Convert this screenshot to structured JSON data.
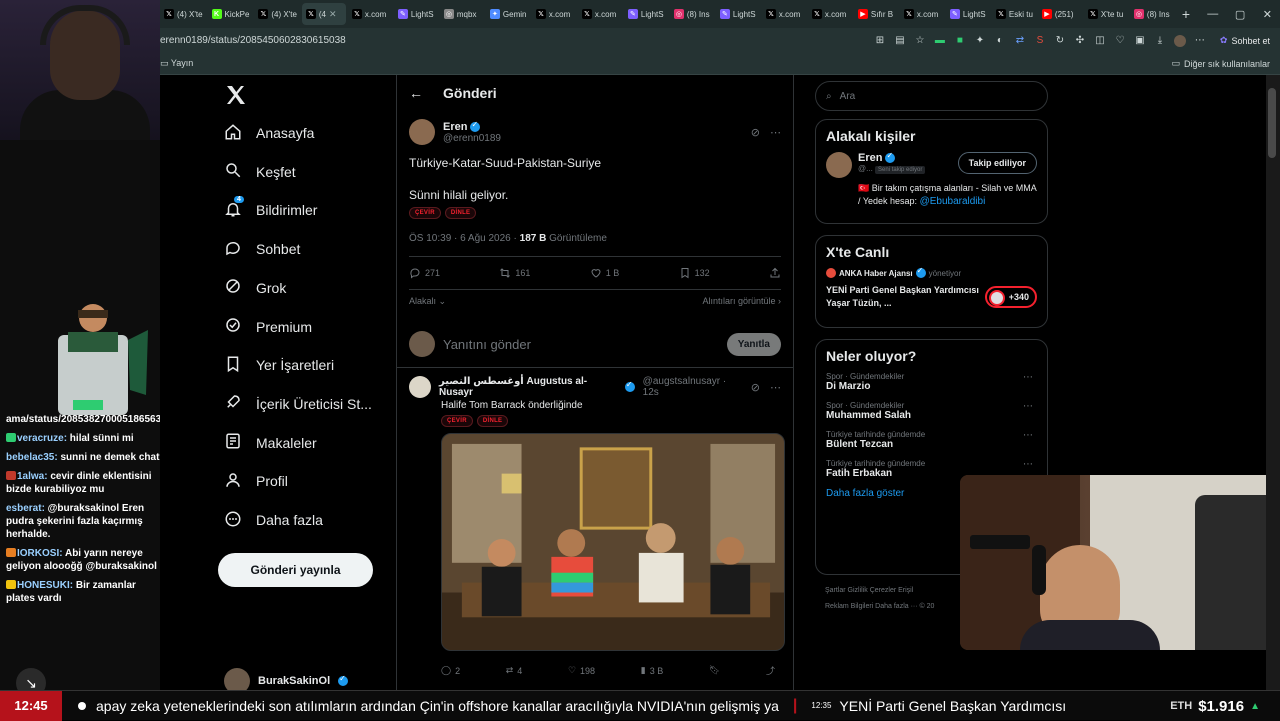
{
  "browser": {
    "tabs": [
      {
        "label": "(4) X'te",
        "icon": "x"
      },
      {
        "label": "KickPe",
        "icon": "kick"
      },
      {
        "label": "(4) X'te",
        "icon": "x"
      },
      {
        "label": "(4",
        "icon": "x",
        "active": true
      },
      {
        "label": "x.com",
        "icon": "x"
      },
      {
        "label": "LightS",
        "icon": "lightshot"
      },
      {
        "label": "mqbx",
        "icon": "globe"
      },
      {
        "label": "Gemin",
        "icon": "gemini"
      },
      {
        "label": "x.com",
        "icon": "x"
      },
      {
        "label": "x.com",
        "icon": "x"
      },
      {
        "label": "LightS",
        "icon": "lightshot"
      },
      {
        "label": "(8) Ins",
        "icon": "instagram"
      },
      {
        "label": "LightS",
        "icon": "lightshot"
      },
      {
        "label": "x.com",
        "icon": "x"
      },
      {
        "label": "x.com",
        "icon": "x"
      },
      {
        "label": "Sıfır B",
        "icon": "youtube"
      },
      {
        "label": "x.com",
        "icon": "x"
      },
      {
        "label": "LightS",
        "icon": "lightshot"
      },
      {
        "label": "Eski tu",
        "icon": "x"
      },
      {
        "label": "(251)",
        "icon": "youtube"
      },
      {
        "label": "X'te tu",
        "icon": "x"
      },
      {
        "label": "(8) Ins",
        "icon": "instagram"
      }
    ],
    "url": "erenn0189/status/2085450602830615038",
    "sohbet_label": "Sohbet et",
    "bookmark_left": "Yayın",
    "bookmark_right": "Diğer sık kullanılanlar"
  },
  "chat": {
    "messages": [
      {
        "user": "",
        "text": "ama/status/2085382700051865635",
        "badge": ""
      },
      {
        "user": "veracruze:",
        "text": " hilal sünni mi",
        "badge": "#2ecc71"
      },
      {
        "user": "bebelac35:",
        "text": " sunni ne demek chat?",
        "badge": ""
      },
      {
        "user": "1alwa:",
        "text": " cevir dinle eklentisini bizde kurabiliyoz mu",
        "badge": "#c0392b"
      },
      {
        "user": "esberat:",
        "text": " @buraksakinol Eren pudra şekerini fazla kaçırmış herhalde.",
        "badge": ""
      },
      {
        "user": "IORKOSI:",
        "text": " Abi yarın nereye geliyon aloooğğ @buraksakinol",
        "badge": "#e67e22"
      },
      {
        "user": "HONESUKI:",
        "text": " Bir zamanlar plates vardı",
        "badge": "#f1c40f"
      }
    ]
  },
  "nav": {
    "items": [
      {
        "label": "Anasayfa",
        "icon": "home-icon"
      },
      {
        "label": "Keşfet",
        "icon": "search-icon"
      },
      {
        "label": "Bildirimler",
        "icon": "bell-icon",
        "badge": "4"
      },
      {
        "label": "Sohbet",
        "icon": "chat-icon"
      },
      {
        "label": "Grok",
        "icon": "grok-icon"
      },
      {
        "label": "Premium",
        "icon": "premium-icon"
      },
      {
        "label": "Yer İşaretleri",
        "icon": "bookmark-icon"
      },
      {
        "label": "İçerik Üreticisi St...",
        "icon": "rocket-icon"
      },
      {
        "label": "Makaleler",
        "icon": "article-icon"
      },
      {
        "label": "Profil",
        "icon": "profile-icon"
      },
      {
        "label": "Daha fazla",
        "icon": "more-icon"
      }
    ],
    "post_button": "Gönderi yayınla",
    "account_name": "BurakSakinOl"
  },
  "main": {
    "header_title": "Gönderi",
    "tweet": {
      "name": "Eren",
      "handle": "@erenn0189",
      "line1": "Türkiye-Katar-Suud-Pakistan-Suriye",
      "line2": "Sünni hilali geliyor.",
      "chip1": "ÇEVİR",
      "chip2": "DİNLE",
      "time": "ÖS 10:39 · 6 Ağu 2026 · ",
      "views": "187 B",
      "views_label": " Görüntüleme",
      "replies": "271",
      "retweets": "161",
      "likes": "1 B",
      "bookmarks": "132",
      "relevance": "Alakalı",
      "quotes_link": "Alıntıları görüntüle"
    },
    "reply": {
      "placeholder": "Yanıtını gönder",
      "button": "Yanıtla"
    },
    "tweet2": {
      "name": "أوغسطس النصير Augustus al-Nusayr",
      "handle": "@augstsalnusayr · 12s",
      "text": "Halife Tom Barrack önderliğinde",
      "chip1": "ÇEVİR",
      "chip2": "DİNLE",
      "replies": "2",
      "retweets": "4",
      "likes": "198",
      "views": "3 B"
    }
  },
  "right": {
    "search_placeholder": "Ara",
    "related_title": "Alakalı kişiler",
    "related_person": {
      "name": "Eren",
      "handle": "@...",
      "follows_you": "Seni takip ediyor",
      "button": "Takip ediliyor",
      "bio_pre": "Bir takım çatışma alanları - Silah ve MMA / Yedek hesap: ",
      "bio_link": "@Ebubaraldibi"
    },
    "live_title": "X'te Canlı",
    "live": {
      "source": "ANKA Haber Ajansı",
      "role": "yönetiyor",
      "headline": "YENİ Parti Genel Başkan Yardımcısı Yaşar Tüzün, ...",
      "count": "+340"
    },
    "trends_title": "Neler oluyor?",
    "trends": [
      {
        "cat": "Spor · Gündemdekiler",
        "name": "Di Marzio"
      },
      {
        "cat": "Spor · Gündemdekiler",
        "name": "Muhammed Salah"
      },
      {
        "cat": "Türkiye tarihinde gündemde",
        "name": "Bülent Tezcan"
      },
      {
        "cat": "Türkiye tarihinde gündemde",
        "name": "Fatih Erbakan"
      }
    ],
    "show_more": "Daha fazla göster",
    "footer_line1": "Şartlar   Gizlilik   Çerezler   Erişil",
    "footer_line2": "Reklam Bilgileri   Daha fazla ···   © 20"
  },
  "ticker": {
    "time": "12:45",
    "text1": "apay zeka yeteneklerindeki son atılımların ardından Çin'in offshore kanallar aracılığıyla NVIDIA'nın gelişmiş ya",
    "separator": "|",
    "time2": "12:35",
    "text2": "YENİ Parti Genel Başkan Yardımcısı",
    "eth_label": "ETH",
    "eth_price": "$1.916",
    "eth_arrow": "▲"
  }
}
